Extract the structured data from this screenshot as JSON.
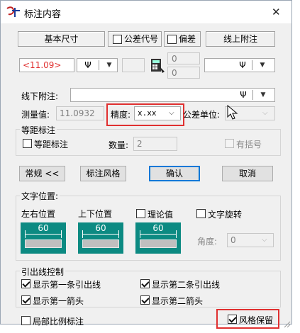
{
  "window": {
    "title": "标注内容",
    "close_glyph": "✕"
  },
  "header": {
    "basic_size": "基本尺寸",
    "tolerance_code": "公差代号",
    "deviation": "偏差",
    "above_line_note": "线上附注"
  },
  "row1": {
    "dim_value": "<11.09>",
    "dim_value_color": "#e03030",
    "symbol_glyph": "Ψ",
    "upper_dev": "0",
    "lower_dev": "0"
  },
  "below_line": {
    "label": "线下附注:",
    "value": ""
  },
  "measure": {
    "label": "测量值:",
    "value": "11.0932",
    "precision_label": "精度:",
    "precision_value": "x.xx",
    "tol_unit_label": "公差单位:"
  },
  "equal": {
    "group_title": "等距标注",
    "checkbox_label": "等距标注",
    "qty_label": "数量:",
    "qty_value": "2",
    "bracket_label": "有括号"
  },
  "buttons": {
    "normal": "常规 <<",
    "style": "标注风格",
    "ok": "确认",
    "cancel": "取消"
  },
  "text_pos": {
    "group_title": "文字位置:",
    "lr_label": "左右位置",
    "ud_label": "上下位置",
    "theory_label": "理论值",
    "rotate_label": "文字旋转",
    "angle_label": "角度:",
    "angle_value": "0",
    "tile_value": "60"
  },
  "leader": {
    "group_title": "引出线控制",
    "show_first_line": "显示第一条引出线",
    "show_second_line": "显示第二条引出线",
    "show_first_arrow": "显示第一箭头",
    "show_second_arrow": "显示第二箭头"
  },
  "bottom": {
    "local_scale": "局部比例标注",
    "keep_style": "风格保留"
  },
  "colors": {
    "highlight": "#e03030",
    "tile": "#0c8a82",
    "accent": "#0078d7"
  }
}
